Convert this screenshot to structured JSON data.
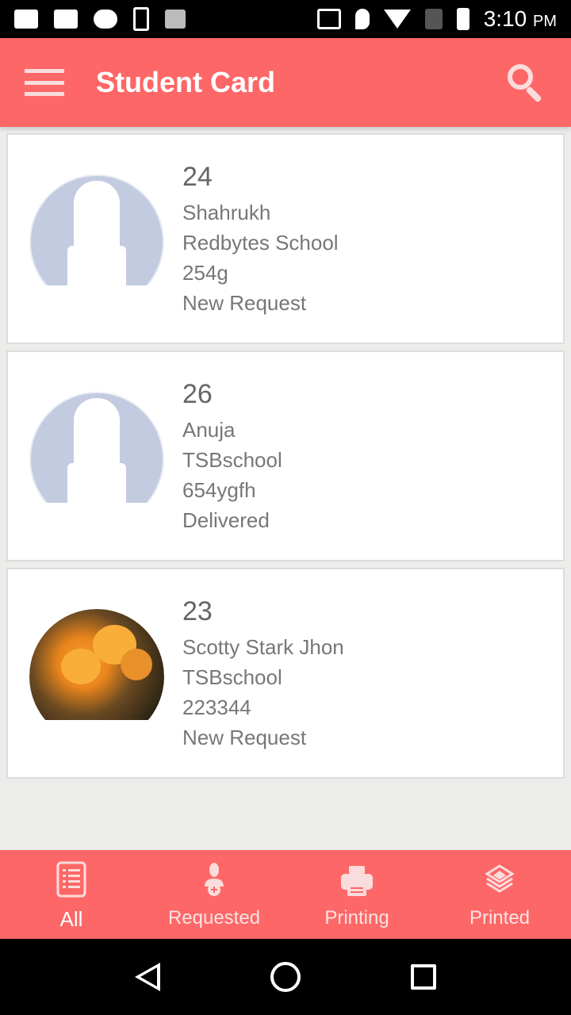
{
  "status_bar": {
    "time": "3:10",
    "ampm": "PM",
    "left_icons": [
      "video-icon",
      "video-icon",
      "cloud-icon",
      "phone-sync-icon",
      "n-icon"
    ],
    "right_icons": [
      "cast-icon",
      "location-icon",
      "wifi-icon",
      "no-signal-icon",
      "battery-charging-icon"
    ]
  },
  "app_bar": {
    "title": "Student Card",
    "menu_icon": "hamburger-menu-icon",
    "search_icon": "search-icon",
    "color": "#fe6767"
  },
  "students": [
    {
      "id": "24",
      "name": "Shahrukh",
      "school": "Redbytes School",
      "code": "254g",
      "status": "New Request",
      "avatar": "default-silhouette"
    },
    {
      "id": "26",
      "name": "Anuja",
      "school": "TSBschool",
      "code": "654ygfh",
      "status": "Delivered",
      "avatar": "default-silhouette"
    },
    {
      "id": "23",
      "name": "Scotty Stark Jhon",
      "school": "TSBschool",
      "code": "223344",
      "status": "New Request",
      "avatar": "flower-photo"
    }
  ],
  "bottom_nav": {
    "items": [
      {
        "label": "All",
        "icon": "list-icon",
        "active": true
      },
      {
        "label": "Requested",
        "icon": "user-add-icon",
        "active": false
      },
      {
        "label": "Printing",
        "icon": "printer-icon",
        "active": false
      },
      {
        "label": "Printed",
        "icon": "layers-icon",
        "active": false
      }
    ]
  },
  "system_nav": {
    "back": "back-icon",
    "home": "home-icon",
    "recents": "recents-icon"
  }
}
